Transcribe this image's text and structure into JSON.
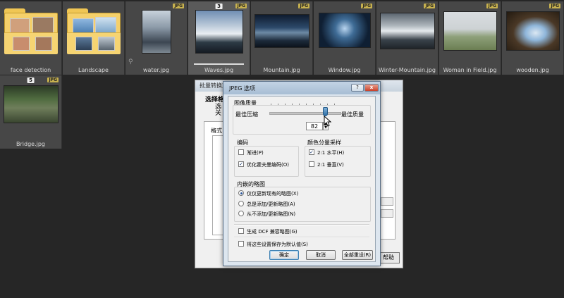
{
  "thumbnails": [
    {
      "label": "face detection",
      "type": "folder"
    },
    {
      "label": "Landscape",
      "type": "folder"
    },
    {
      "label": "water.jpg",
      "badge": "JPG",
      "pin": true,
      "style": "p-water"
    },
    {
      "label": "Waves.jpg",
      "badge": "JPG",
      "number": "3",
      "selected": true,
      "style": "p-waves"
    },
    {
      "label": "Mountain.jpg",
      "badge": "JPG",
      "style": "p-mountain"
    },
    {
      "label": "Window.jpg",
      "badge": "JPG",
      "style": "p-window"
    },
    {
      "label": "Winter-Mountain.jpg",
      "badge": "JPG",
      "style": "p-winter"
    },
    {
      "label": "Woman in Field.jpg",
      "badge": "JPG",
      "style": "p-woman"
    },
    {
      "label": "wooden.jpg",
      "badge": "JPG",
      "style": "p-wooden"
    },
    {
      "label": "Bridge.jpg",
      "badge": "JPG",
      "number": "5",
      "style": "p-bridge"
    }
  ],
  "back_dialog": {
    "title": "批量转换文",
    "heading": "选择格",
    "sub1": "选",
    "sub2": "关",
    "format_label": "格式",
    "help_button": "帮助"
  },
  "jpeg_dialog": {
    "title": "JPEG 选项",
    "help_glyph": "?",
    "close_glyph": "x",
    "quality": {
      "group_label": "图像质量",
      "min_label": "最佳压缩",
      "max_label": "最佳质量",
      "value": "82",
      "spin_up": "▲",
      "spin_down": "▼"
    },
    "encoding": {
      "group_label": "编码",
      "progressive": "渐进(P)",
      "optimize": "优化霍夫曼编码(O)",
      "check_mark": "✓"
    },
    "subsampling": {
      "group_label": "颜色分量采样",
      "horizontal": "2:1 水平(H)",
      "vertical": "2:1 垂直(V)"
    },
    "thumbnail": {
      "group_label": "内嵌的略图",
      "opt_update": "仅仅更新现有的略图(X)",
      "opt_add": "总是添加/更新略图(A)",
      "opt_none": "从不添加/更新略图(N)"
    },
    "dcf": "生成 DCF 兼容略图(G)",
    "save_default": "将这些设置保存为默认值(S)",
    "buttons": {
      "ok": "确定",
      "cancel": "取消",
      "reset": "全部重设(R)"
    }
  }
}
